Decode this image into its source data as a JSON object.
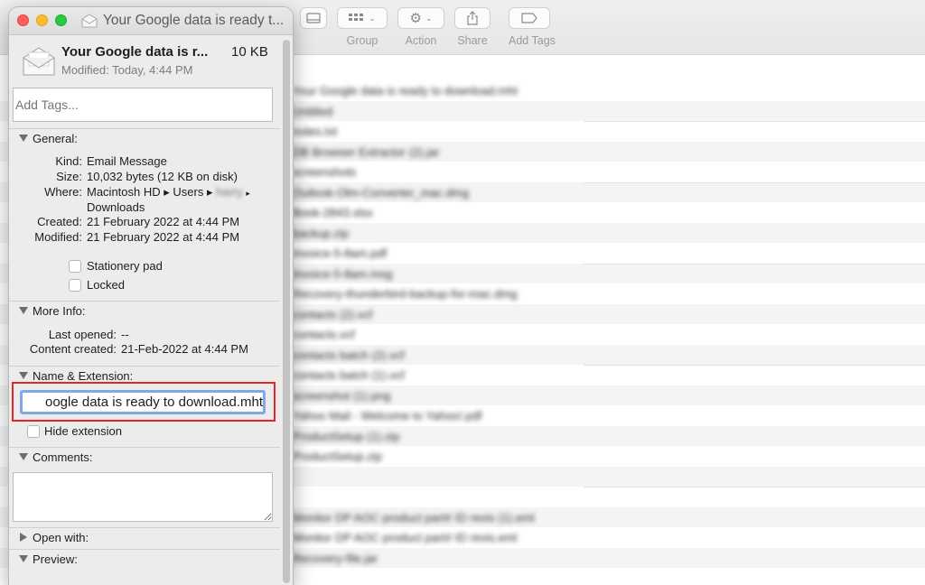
{
  "finder": {
    "toolbar": [
      {
        "id": "view",
        "label": ""
      },
      {
        "id": "group",
        "label": "Group"
      },
      {
        "id": "action",
        "label": "Action"
      },
      {
        "id": "share",
        "label": "Share"
      },
      {
        "id": "add_tags",
        "label": "Add Tags"
      }
    ],
    "files": [
      "Your Google data is ready to download.mht",
      "Untitled",
      "notes.txt",
      "DB Browser Extractor (2).jar",
      "screenshots",
      "Outlook-Olm-Converter_mac.dmg",
      "Book-2843.xlsx",
      "backup.zip",
      "Invoice-5-8am.pdf",
      "Invoice-5-8am.msg",
      "Recovery-thunderbird-backup-for-mac.dmg",
      "contacts (2).vcf",
      "contacts.vcf",
      "contacts batch (2).vcf",
      "contacts batch (1).vcf",
      "screenshot (1).png",
      "Yahoo Mail - Welcome to Yahoo!.pdf",
      "ProductSetup (1).zip",
      "ProductSetup.zip",
      "",
      "",
      "Monitor DP AOC product part# ID revis (1).eml",
      "Monitor DP AOC product part# ID revis.eml",
      "Recovery-file.jar"
    ]
  },
  "info": {
    "window_title": "Your Google data is ready t...",
    "file_name": "Your Google data is r...",
    "file_size": "10 KB",
    "modified": "Modified: Today, 4:44 PM",
    "tags_placeholder": "Add Tags...",
    "general": {
      "heading": "General:",
      "kind_label": "Kind:",
      "kind_value": "Email Message",
      "size_label": "Size:",
      "size_value": "10,032 bytes (12 KB on disk)",
      "where_label": "Where:",
      "where_value_1": "Macintosh HD ▸ Users ▸",
      "where_value_user": "harry",
      "where_value_arrow": "▸",
      "where_value_2": "Downloads",
      "created_label": "Created:",
      "created_value": "21 February 2022 at 4:44 PM",
      "modified_label": "Modified:",
      "modified_value": "21 February 2022 at 4:44 PM",
      "stationery_label": "Stationery pad",
      "locked_label": "Locked"
    },
    "more_info": {
      "heading": "More Info:",
      "last_opened_label": "Last opened:",
      "last_opened_value": "--",
      "content_created_label": "Content created:",
      "content_created_value": "21-Feb-2022 at 4:44 PM"
    },
    "name_ext": {
      "heading": "Name & Extension:",
      "value": "oogle data is ready to download.mht",
      "hide_extension_label": "Hide extension"
    },
    "comments": {
      "heading": "Comments:"
    },
    "open_with": {
      "heading": "Open with:"
    },
    "preview": {
      "heading": "Preview:"
    }
  }
}
